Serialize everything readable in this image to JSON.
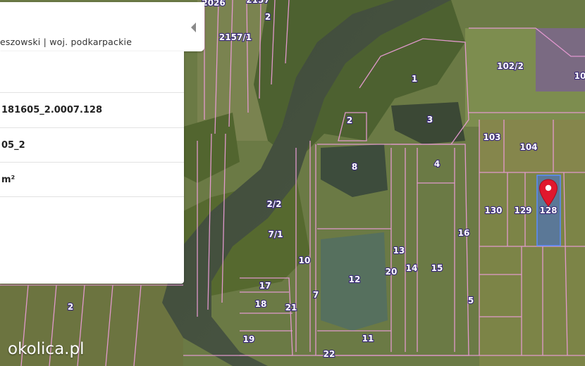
{
  "panel": {
    "location": "eszowski | woj. podkarpackie",
    "parcel_id": "181605_2.0007.128",
    "precinct": "05_2",
    "area_unit": "m²",
    "collapse_icon": "chevron-left-icon"
  },
  "map": {
    "parcels": [
      "2026",
      "2157/1",
      "2157",
      "2",
      "1",
      "102/2",
      "10",
      "2",
      "3",
      "103",
      "104",
      "8",
      "4",
      "130",
      "129",
      "128",
      "2/2",
      "7/1",
      "16",
      "13",
      "10",
      "20",
      "14",
      "15",
      "12",
      "17",
      "18",
      "21",
      "7",
      "5",
      "2",
      "19",
      "11",
      "22"
    ],
    "selected_parcel": "128",
    "marker_icon": "map-pin-icon",
    "boundary_color": "#e89bd4",
    "selected_fill": "#3f6fd8",
    "marker_color": "#e0182d"
  },
  "brand": {
    "logo": "okolica.pl"
  }
}
